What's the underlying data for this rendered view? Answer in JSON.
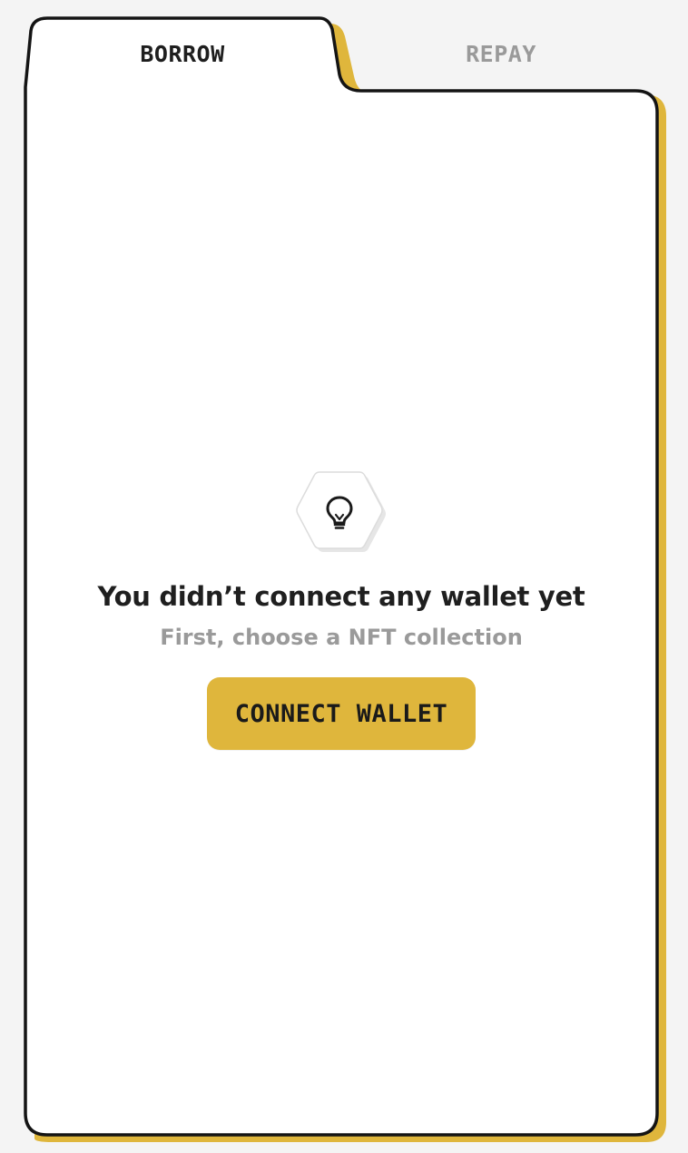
{
  "tabs": [
    {
      "label": "BORROW",
      "active": true
    },
    {
      "label": "REPAY",
      "active": false
    }
  ],
  "empty_state": {
    "icon": "lightbulb-icon",
    "title": "You didn’t connect any wallet yet",
    "subtitle": "First, choose a NFT collection",
    "button_label": "CONNECT WALLET"
  },
  "colors": {
    "accent": "#dfb63c",
    "page_background": "#f4f4f4",
    "card_background": "#ffffff",
    "card_border": "#141414",
    "inactive_tab_text": "#9a9a9a",
    "subtitle_text": "#9a9a9a"
  }
}
